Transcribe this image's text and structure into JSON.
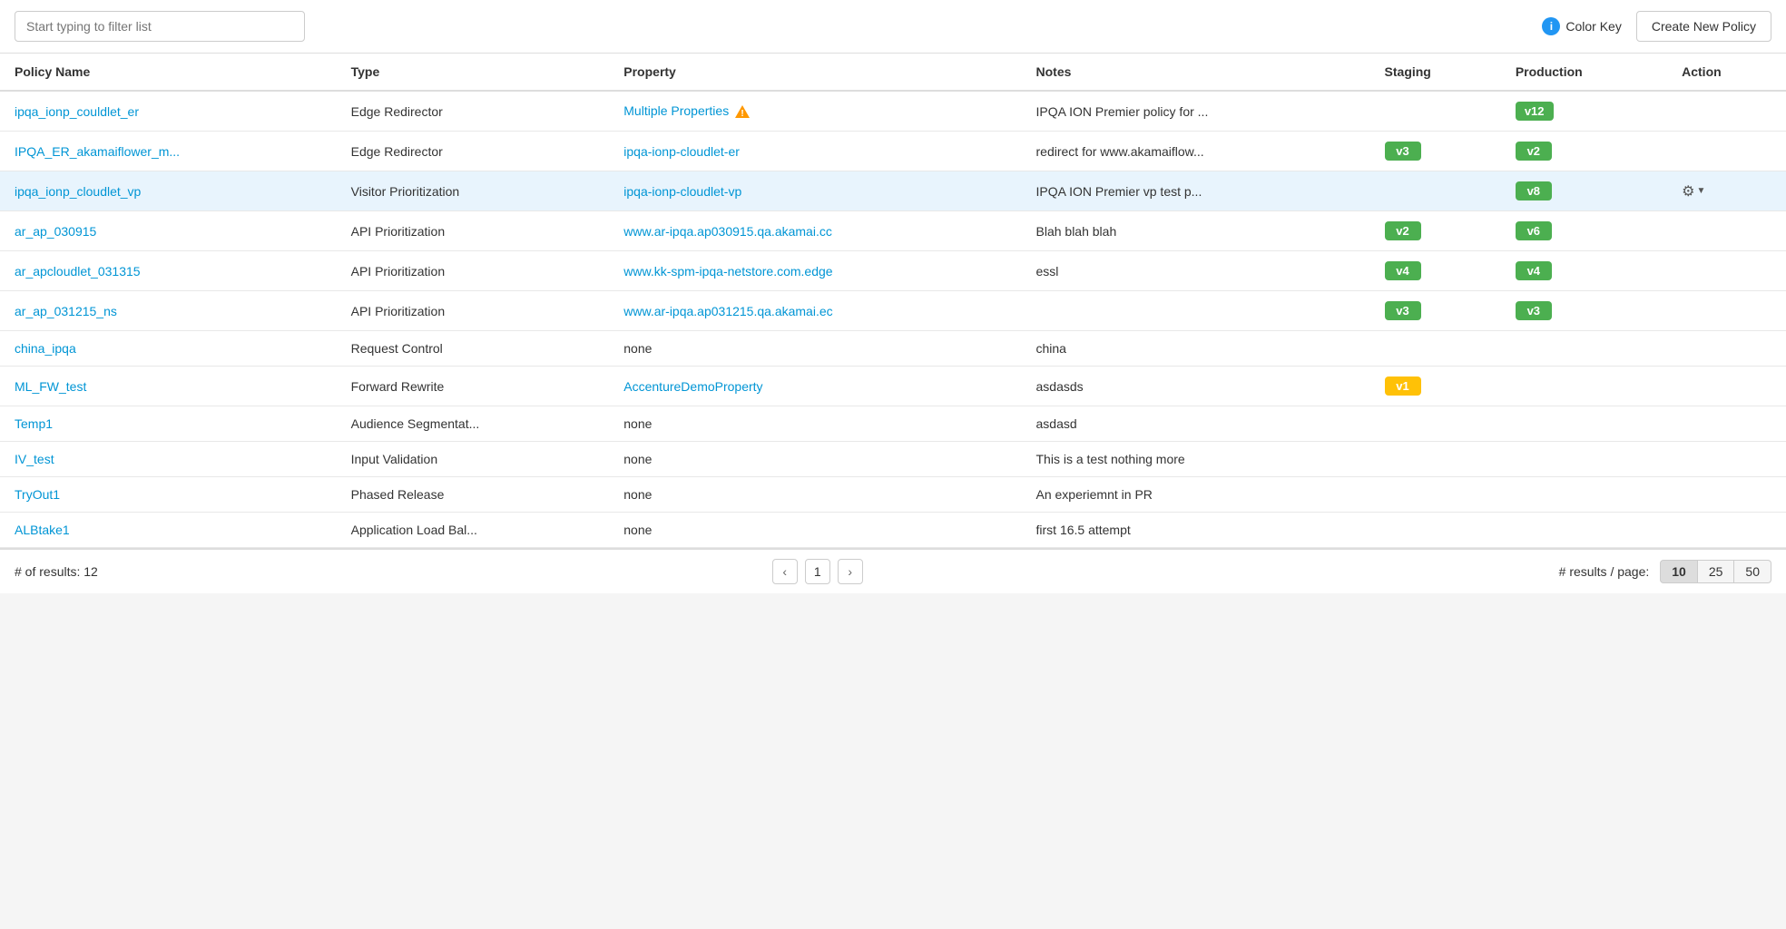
{
  "topbar": {
    "filter_placeholder": "Start typing to filter list",
    "color_key_label": "Color Key",
    "create_btn_label": "Create New Policy"
  },
  "table": {
    "headers": [
      "Policy Name",
      "Type",
      "Property",
      "Notes",
      "Staging",
      "Production",
      "Action"
    ],
    "rows": [
      {
        "name": "ipqa_ionp_couldlet_er",
        "type": "Edge Redirector",
        "property": "Multiple Properties",
        "property_warn": true,
        "notes": "IPQA ION Premier policy for ...",
        "staging": null,
        "production": {
          "label": "v12",
          "color": "green"
        },
        "action": false,
        "highlighted": false
      },
      {
        "name": "IPQA_ER_akamaiflower_m...",
        "type": "Edge Redirector",
        "property": "ipqa-ionp-cloudlet-er",
        "property_warn": false,
        "notes": "redirect for www.akamaiflow...",
        "staging": {
          "label": "v3",
          "color": "green"
        },
        "production": {
          "label": "v2",
          "color": "green"
        },
        "action": false,
        "highlighted": false
      },
      {
        "name": "ipqa_ionp_cloudlet_vp",
        "type": "Visitor Prioritization",
        "property": "ipqa-ionp-cloudlet-vp",
        "property_warn": false,
        "notes": "IPQA ION Premier vp test p...",
        "staging": null,
        "production": {
          "label": "v8",
          "color": "green"
        },
        "action": true,
        "highlighted": true
      },
      {
        "name": "ar_ap_030915",
        "type": "API Prioritization",
        "property": "www.ar-ipqa.ap030915.qa.akamai.cc",
        "property_warn": false,
        "notes": "Blah blah blah",
        "staging": {
          "label": "v2",
          "color": "green"
        },
        "production": {
          "label": "v6",
          "color": "green"
        },
        "action": false,
        "highlighted": false
      },
      {
        "name": "ar_apcloudlet_031315",
        "type": "API Prioritization",
        "property": "www.kk-spm-ipqa-netstore.com.edge",
        "property_warn": false,
        "notes": "essl",
        "staging": {
          "label": "v4",
          "color": "green"
        },
        "production": {
          "label": "v4",
          "color": "green"
        },
        "action": false,
        "highlighted": false
      },
      {
        "name": "ar_ap_031215_ns",
        "type": "API Prioritization",
        "property": "www.ar-ipqa.ap031215.qa.akamai.ec",
        "property_warn": false,
        "notes": "",
        "staging": {
          "label": "v3",
          "color": "green"
        },
        "production": {
          "label": "v3",
          "color": "green"
        },
        "action": false,
        "highlighted": false
      },
      {
        "name": "china_ipqa",
        "type": "Request Control",
        "property": "none",
        "property_warn": false,
        "notes": "china",
        "staging": null,
        "production": null,
        "action": false,
        "highlighted": false
      },
      {
        "name": "ML_FW_test",
        "type": "Forward Rewrite",
        "property": "AccentureDemoProperty",
        "property_warn": false,
        "notes": "asdasds",
        "staging": {
          "label": "v1",
          "color": "yellow"
        },
        "production": null,
        "action": false,
        "highlighted": false
      },
      {
        "name": "Temp1",
        "type": "Audience Segmentat...",
        "property": "none",
        "property_warn": false,
        "notes": "asdasd",
        "staging": null,
        "production": null,
        "action": false,
        "highlighted": false
      },
      {
        "name": "IV_test",
        "type": "Input Validation",
        "property": "none",
        "property_warn": false,
        "notes": "This is a test nothing more",
        "staging": null,
        "production": null,
        "action": false,
        "highlighted": false
      },
      {
        "name": "TryOut1",
        "type": "Phased Release",
        "property": "none",
        "property_warn": false,
        "notes": "An experiemnt in PR",
        "staging": null,
        "production": null,
        "action": false,
        "highlighted": false
      },
      {
        "name": "ALBtake1",
        "type": "Application Load Bal...",
        "property": "none",
        "property_warn": false,
        "notes": "first 16.5 attempt",
        "staging": null,
        "production": null,
        "action": false,
        "highlighted": false
      }
    ]
  },
  "pagination": {
    "results_label": "# of results: 12",
    "current_page": "1",
    "per_page_label": "# results / page:",
    "per_page_options": [
      "10",
      "25",
      "50"
    ],
    "active_per_page": "10"
  }
}
